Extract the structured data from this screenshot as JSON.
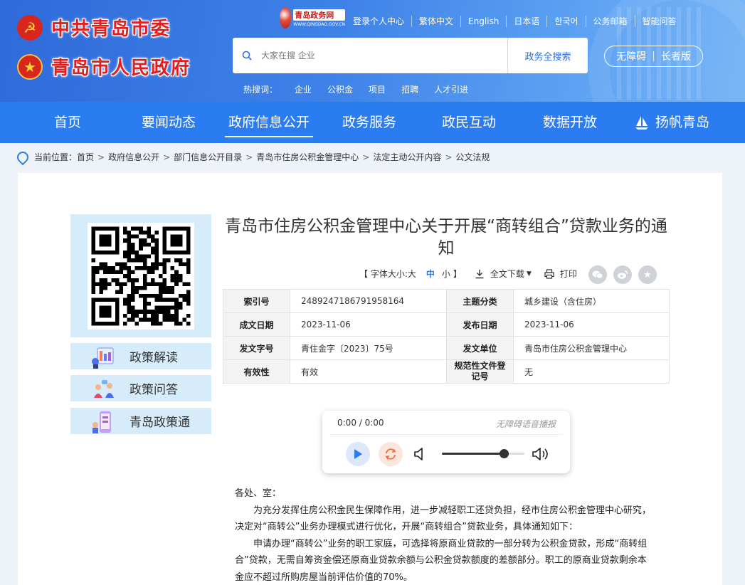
{
  "header": {
    "party_name": "中共青岛市委",
    "gov_name": "青岛市人民政府",
    "portal_name": "青岛政务网",
    "portal_sub": "WWW.QINGDAO.GOV.CN",
    "top_links": [
      "登录个人中心",
      "繁体中文",
      "English",
      "日本语",
      "한국어",
      "公务邮箱",
      "智能问答"
    ],
    "search": {
      "placeholder": "大家在搜 企业",
      "button": "政务全搜索"
    },
    "accessibility": {
      "barrier_free": "无障碍",
      "elder": "长者版"
    },
    "hot_label": "热搜词：",
    "hot_words": [
      "企业",
      "公积金",
      "项目",
      "招聘",
      "人才引进"
    ]
  },
  "nav": {
    "items": [
      "首页",
      "要闻动态",
      "政府信息公开",
      "政务服务",
      "政民互动",
      "数据开放",
      "扬帆青岛"
    ],
    "active_index": 2
  },
  "breadcrumb": {
    "label": "当前位置：",
    "items": [
      "首页",
      "政府信息公开",
      "部门信息公开目录",
      "青岛市住房公积金管理中心",
      "法定主动公开内容",
      "公文法规"
    ]
  },
  "sidebar": {
    "buttons": [
      "政策解读",
      "政策问答",
      "青岛政策通"
    ]
  },
  "article": {
    "title": "青岛市住房公积金管理中心关于开展“商转组合”贷款业务的通知",
    "font_size_label": "【 字体大小:",
    "font_large": "大",
    "font_mid": "中",
    "font_small": "小",
    "font_close": "】",
    "download": "全文下载",
    "print": "打印",
    "meta": {
      "index_no_label": "索引号",
      "index_no": "2489247186791958164",
      "topic_label": "主题分类",
      "topic": "城乡建设（含住房）",
      "created_label": "成文日期",
      "created": "2023-11-06",
      "published_label": "发布日期",
      "published": "2023-11-06",
      "doc_no_label": "发文字号",
      "doc_no": "青住金字〔2023〕75号",
      "issuer_label": "发文单位",
      "issuer": "青岛市住房公积金管理中心",
      "validity_label": "有效性",
      "validity": "有效",
      "registry_label": "规范性文件登记号",
      "registry": "无"
    },
    "player": {
      "time": "0:00 / 0:00",
      "accessible_label": "无障碍语音播报",
      "volume_level": 0.75
    },
    "greeting": "各处、室：",
    "paragraphs": [
      "为充分发挥住房公积金民生保障作用，进一步减轻职工还贷负担，经市住房公积金管理中心研究，决定对“商转公”业务办理模式进行优化，开展“商转组合”贷款业务，具体通知如下：",
      "申请办理“商转公”业务的职工家庭，可选择将原商业贷款的一部分转为公积金贷款，形成“商转组合”贷款，无需自筹资金偿还原商业贷款余额与公积金贷款额度的差额部分。职工的原商业贷款剩余本金应不超过所购房屋当前评估价值的70%。"
    ]
  },
  "colors": {
    "nav_bg": "#2b7cf0",
    "header_bg": "#3e82e8",
    "accent": "#2b7cf0",
    "logo_red": "#e02020"
  }
}
